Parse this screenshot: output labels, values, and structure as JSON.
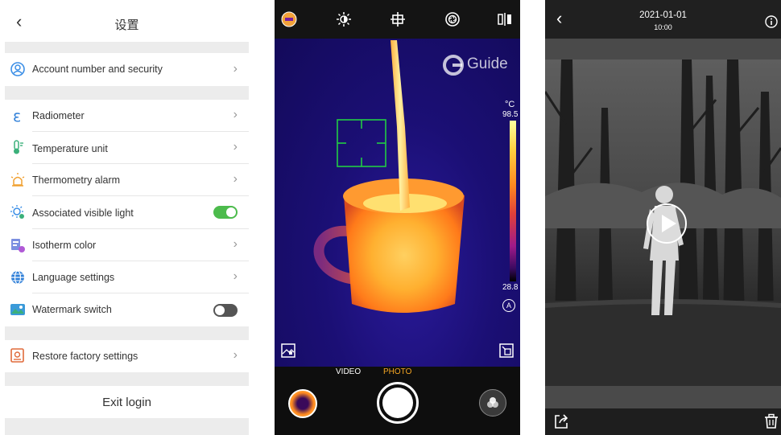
{
  "settings": {
    "title": "设置",
    "items": [
      {
        "label": "Account number and security",
        "icon": "account-security-icon"
      },
      {
        "label": "Radiometer",
        "icon": "radiometer-icon"
      },
      {
        "label": "Temperature unit",
        "icon": "thermometer-icon"
      },
      {
        "label": "Thermometry alarm",
        "icon": "alarm-icon"
      },
      {
        "label": "Associated visible light",
        "icon": "visible-light-icon",
        "toggle": true
      },
      {
        "label": "Isotherm color",
        "icon": "isotherm-icon"
      },
      {
        "label": "Language settings",
        "icon": "globe-icon"
      },
      {
        "label": "Watermark switch",
        "icon": "watermark-icon",
        "toggle": false
      },
      {
        "label": "Restore factory settings",
        "icon": "restore-icon"
      }
    ],
    "exit_label": "Exit login",
    "colors": {
      "toggle_on": "#4cbb4c",
      "toggle_off": "#555555",
      "account_icon": "#3a8ee6",
      "radiometer_icon": "#2f7fd8"
    }
  },
  "camera": {
    "brand": "Guide",
    "unit": "°C",
    "temp_max": "98.5",
    "temp_min": "28.8",
    "auto_label": "A",
    "modes": {
      "video": "VIDEO",
      "photo": "PHOTO"
    },
    "active_mode": "PHOTO",
    "colors": {
      "active_mode": "#f5a623",
      "target_box": "#22cc44"
    },
    "top_icons": [
      "palette-icon",
      "brightness-icon",
      "crosshair-icon",
      "shutter-calibrate-icon",
      "compare-icon"
    ]
  },
  "playback": {
    "date": "2021-01-01",
    "time": "10:00",
    "bottom_icons": [
      "share-icon",
      "trash-icon"
    ]
  }
}
